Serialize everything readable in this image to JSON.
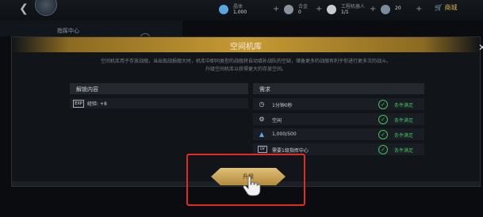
{
  "topbar": {
    "back_icon": "arrow-left-icon",
    "resources": [
      {
        "label": "晶体",
        "value": "1,000",
        "color": "#5aa7e0"
      },
      {
        "label": "合金",
        "value": "0",
        "color": "#8a929c"
      },
      {
        "label": "工程机器人",
        "value": "1/1",
        "color": "#c7ccd3"
      },
      {
        "label": "",
        "value": "20",
        "color": "#7c8c9c"
      }
    ],
    "shop_label": "商城"
  },
  "background": {
    "panel_title": "指挥中心"
  },
  "dialog": {
    "title": "空间机库",
    "description_lines": [
      "空间机库用于存放战舰，当出现战损舰大时，机库中即同类型的战舰将自动填补战队的空缺，储备更多的战舰有利于你进行更多次的战斗。",
      "升级空间机库以获得更大的存放空间。"
    ],
    "unlock_header": "解锁内容",
    "unlock_items": [
      {
        "icon_text": "EXP",
        "text": "经验: +8"
      }
    ],
    "req_header": "需求",
    "requirements": [
      {
        "icon": "clock-icon",
        "text": "1分钟0秒",
        "status": "条件满足"
      },
      {
        "icon": "robot-icon",
        "text": "空闲",
        "status": "条件满足"
      },
      {
        "icon": "crystal-icon",
        "text": "1,000/500",
        "status": "条件满足"
      },
      {
        "icon": "level-icon",
        "icon_text": "LV",
        "text": "需要1级指挥中心",
        "status": "条件满足"
      }
    ],
    "upgrade_label": "升级"
  },
  "colors": {
    "accent_gold": "#c79a34",
    "success_green": "#3fbf5c",
    "highlight_red": "#e12b26"
  }
}
